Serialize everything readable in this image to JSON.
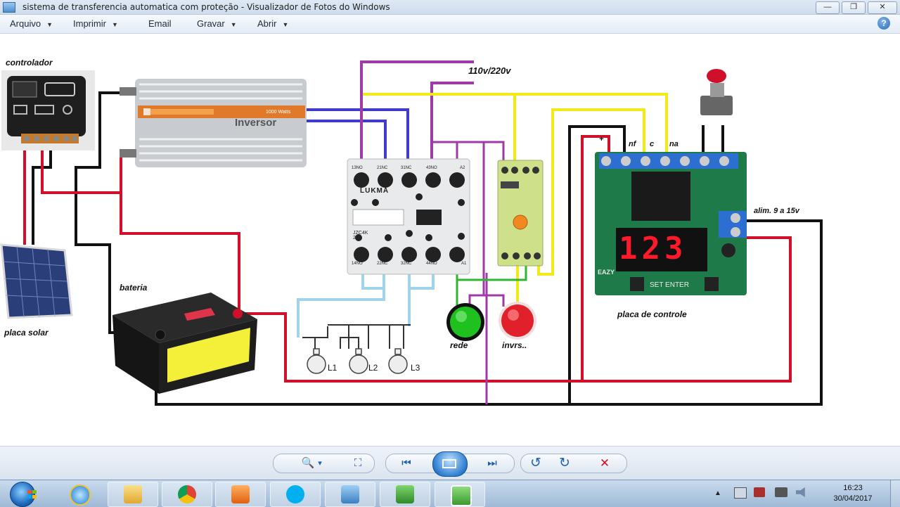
{
  "window": {
    "title": "sistema de transferencia automatica com proteção - Visualizador de Fotos do Windows",
    "minimize_glyph": "—",
    "maximize_glyph": "❐",
    "close_glyph": "✕"
  },
  "menu": {
    "items": [
      {
        "label": "Arquivo",
        "has_dropdown": true
      },
      {
        "label": "Imprimir",
        "has_dropdown": true
      },
      {
        "label": "Email",
        "has_dropdown": false
      },
      {
        "label": "Gravar",
        "has_dropdown": true
      },
      {
        "label": "Abrir",
        "has_dropdown": true
      }
    ],
    "dropdown_glyph": "▼",
    "help_glyph": "?"
  },
  "diagram": {
    "labels": {
      "controlador": "controlador",
      "inversor": "Inversor",
      "inverter_rating": "1000 Watts",
      "supply": "110v/220v",
      "contactor_brand": "LUKMA",
      "contactor_model": "JZC4K 22",
      "contact_top": [
        "13NO",
        "21NC",
        "31NC",
        "43NO",
        "A2"
      ],
      "contact_bottom": [
        "14NO",
        "22NC",
        "32NC",
        "44NO",
        "A1"
      ],
      "bateria": "bateria",
      "placa_solar": "placa solar",
      "lamp_1": "L1",
      "lamp_2": "L2",
      "lamp_3": "L3",
      "rede": "rede",
      "inversor_lamp": "invrs..",
      "relay_terminals": [
        "nf",
        "c",
        "na"
      ],
      "relay_plus": "+",
      "alimentacao": "alim. 9 a 15v",
      "placa_controle": "placa de controle",
      "board_display": "123",
      "board_brand": "EAZY",
      "board_buttons": "SET ENTER"
    },
    "colors": {
      "black": "#111111",
      "red": "#d0102a",
      "purple": "#a03aa8",
      "blue": "#3c3cc8",
      "yellow": "#f2ea16",
      "light_blue": "#9fd4ea",
      "green": "#2fb52f"
    }
  },
  "viewer_toolbar": {
    "buttons": [
      {
        "name": "zoom-icon",
        "glyph": "🔍"
      },
      {
        "name": "fit-window-icon",
        "glyph": "⛶"
      },
      {
        "name": "previous-icon",
        "glyph": "⏮"
      },
      {
        "name": "slideshow-icon",
        "glyph": ""
      },
      {
        "name": "next-icon",
        "glyph": "⏭"
      },
      {
        "name": "rotate-left-icon",
        "glyph": "↺"
      },
      {
        "name": "rotate-right-icon",
        "glyph": "↻"
      },
      {
        "name": "delete-icon",
        "glyph": "✕"
      }
    ],
    "zoom_dropdown_glyph": "▾"
  },
  "taskbar": {
    "apps": [
      {
        "name": "internet-explorer-icon"
      },
      {
        "name": "file-explorer-icon"
      },
      {
        "name": "chrome-icon"
      },
      {
        "name": "media-player-icon"
      },
      {
        "name": "skype-icon"
      },
      {
        "name": "photo-viewer-icon"
      },
      {
        "name": "camtasia-icon"
      },
      {
        "name": "camtasia-recorder-icon"
      }
    ],
    "tray_arrow": "▲",
    "clock": {
      "time": "16:23",
      "date": "30/04/2017"
    }
  }
}
